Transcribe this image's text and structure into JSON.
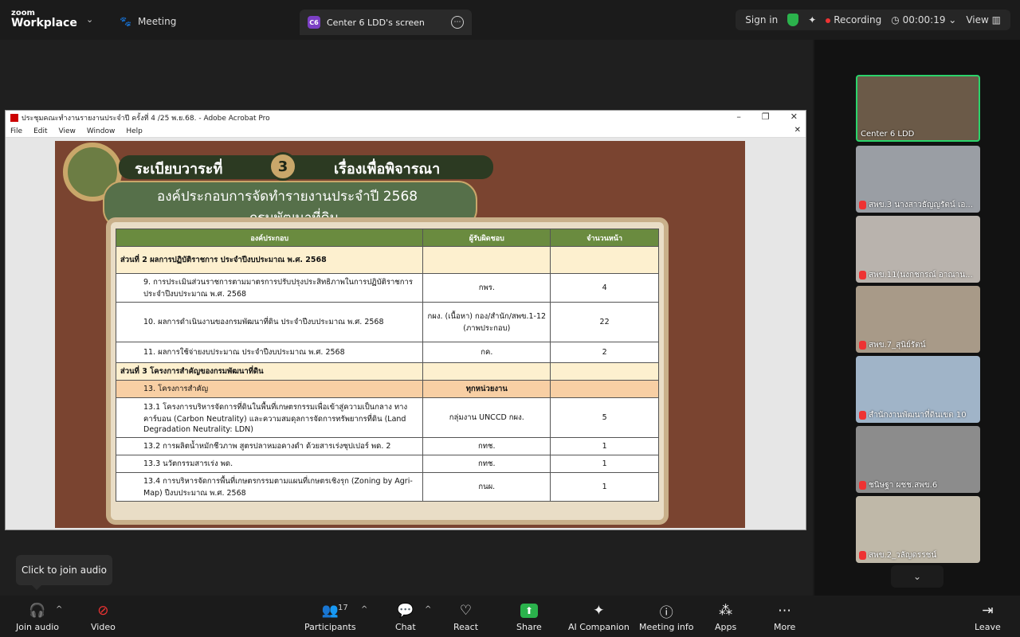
{
  "topbar": {
    "logo_line1": "zoom",
    "logo_line2": "Workplace",
    "meeting_label": "Meeting",
    "screen_tab_initials": "C6",
    "screen_tab_label": "Center 6 LDD's screen",
    "sign_in": "Sign in",
    "recording": "Recording",
    "timer": "00:00:19",
    "view": "View"
  },
  "acrobat": {
    "title": "ประชุมคณะทำงานรายงานประจำปี ครั้งที่ 4 /25 พ.ย.68. - Adobe Acrobat Pro",
    "menu": [
      "File",
      "Edit",
      "View",
      "Window",
      "Help"
    ]
  },
  "slide": {
    "agenda_label": "ระเบียบวาระที่",
    "agenda_number": "3",
    "agenda_topic": "เรื่องเพื่อพิจารณา",
    "heading1": "องค์ประกอบการจัดทำรายงานประจำปี 2568",
    "heading2": "กรมพัฒนาที่ดิน",
    "table": {
      "headers": [
        "องค์ประกอบ",
        "ผู้รับผิดชอบ",
        "จำนวนหน้า"
      ],
      "section2": "ส่วนที่ 2 ผลการปฏิบัติราชการ ประจำปีงบประมาณ พ.ศ. 2568",
      "r9": [
        "9. การประเมินส่วนราชการตามมาตรการปรับปรุงประสิทธิภาพในการปฏิบัติราชการ ประจำปีงบประมาณ พ.ศ. 2568",
        "กพร.",
        "4"
      ],
      "r10": [
        "10. ผลการดำเนินงานของกรมพัฒนาที่ดิน ประจำปีงบประมาณ พ.ศ. 2568",
        "กผง. (เนื้อหา) กอง/สำนัก/สพข.1-12 (ภาพประกอบ)",
        "22"
      ],
      "r11": [
        "11. ผลการใช้จ่ายงบประมาณ ประจำปีงบประมาณ พ.ศ. 2568",
        "กค.",
        "2"
      ],
      "section3": "ส่วนที่ 3 โครงการสำคัญของกรมพัฒนาที่ดิน",
      "r13": [
        "13. โครงการสำคัญ",
        "ทุกหน่วยงาน",
        ""
      ],
      "r131": [
        "13.1 โครงการบริหารจัดการที่ดินในพื้นที่เกษตรกรรมเพื่อเข้าสู่ความเป็นกลาง ทางคาร์บอน (Carbon Neutrality) และความสมดุลการจัดการทรัพยากรที่ดิน (Land Degradation Neutrality: LDN)",
        "กลุ่มงาน UNCCD กผง.",
        "5"
      ],
      "r132": [
        "13.2 การผลิตน้ำหมักชีวภาพ สูตรปลาหมอคางดำ ด้วยสารเร่งซุปเปอร์ พด. 2",
        "กทช.",
        "1"
      ],
      "r133": [
        "13.3 นวัตกรรมสารเร่ง พด.",
        "กทช.",
        "1"
      ],
      "r134": [
        "13.4 การบริหารจัดการพื้นที่เกษตรกรรมตามแผนที่เกษตรเชิงรุก (Zoning by Agri-Map) ปีงบประมาณ พ.ศ. 2568",
        "กนผ.",
        "1"
      ]
    }
  },
  "gallery": {
    "participants": [
      {
        "name": "Center 6 LDD",
        "muted": false
      },
      {
        "name": "สพข.3 นางสาวธัญญรัตน์ เอ...",
        "muted": true
      },
      {
        "name": "สพข.11(นงกชกรณ์ อาณาน...",
        "muted": true
      },
      {
        "name": "สพข.7_สุนิย์รัตน์",
        "muted": true
      },
      {
        "name": "สำนักงานพัฒนาที่ดินเขต 10",
        "muted": true
      },
      {
        "name": "ชนิษฐา ผชช.สพข.6",
        "muted": true
      },
      {
        "name": "สพข.2_วลัญดรรชน์",
        "muted": true
      }
    ]
  },
  "tooltip": "Click to join audio",
  "toolbar": {
    "join_audio": "Join audio",
    "video": "Video",
    "participants": "Participants",
    "participants_count": "17",
    "chat": "Chat",
    "react": "React",
    "share": "Share",
    "ai_companion": "AI Companion",
    "meeting_info": "Meeting info",
    "apps": "Apps",
    "more": "More",
    "leave": "Leave"
  },
  "colors": {
    "accent_green": "#2bb24c",
    "record_red": "#e33333",
    "table_header": "#6a8b3f"
  }
}
